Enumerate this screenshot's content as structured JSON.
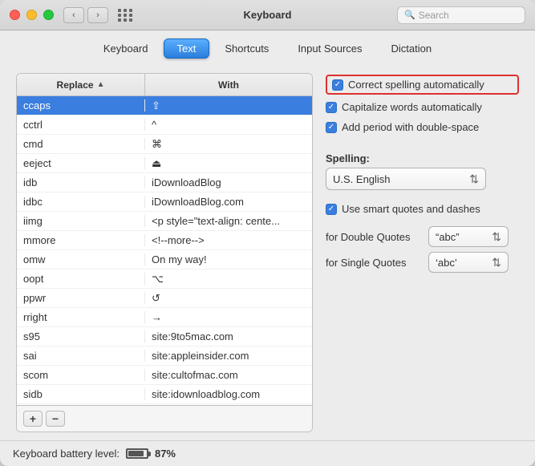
{
  "window": {
    "title": "Keyboard"
  },
  "titlebar": {
    "title": "Keyboard",
    "search_placeholder": "Search"
  },
  "tabs": [
    {
      "label": "Keyboard",
      "active": false
    },
    {
      "label": "Text",
      "active": true
    },
    {
      "label": "Shortcuts",
      "active": false
    },
    {
      "label": "Input Sources",
      "active": false
    },
    {
      "label": "Dictation",
      "active": false
    }
  ],
  "table": {
    "col_replace": "Replace",
    "col_with": "With",
    "rows": [
      {
        "replace": "ccaps",
        "with": "⇧",
        "selected": true
      },
      {
        "replace": "cctrl",
        "with": "^",
        "selected": false
      },
      {
        "replace": "cmd",
        "with": "⌘",
        "selected": false
      },
      {
        "replace": "eeject",
        "with": "⏏",
        "selected": false
      },
      {
        "replace": "idb",
        "with": "iDownloadBlog",
        "selected": false
      },
      {
        "replace": "idbc",
        "with": "iDownloadBlog.com",
        "selected": false
      },
      {
        "replace": "iimg",
        "with": "<p style=\"text-align: cente...",
        "selected": false
      },
      {
        "replace": "mmore",
        "with": "<!--more-->",
        "selected": false
      },
      {
        "replace": "omw",
        "with": "On my way!",
        "selected": false
      },
      {
        "replace": "oopt",
        "with": "⌥",
        "selected": false
      },
      {
        "replace": "ppwr",
        "with": "↺",
        "selected": false
      },
      {
        "replace": "rright",
        "with": "→",
        "selected": false
      },
      {
        "replace": "s95",
        "with": "site:9to5mac.com",
        "selected": false
      },
      {
        "replace": "sai",
        "with": "site:appleinsider.com",
        "selected": false
      },
      {
        "replace": "scom",
        "with": "site:cultofmac.com",
        "selected": false
      },
      {
        "replace": "sidb",
        "with": "site:idownloadblog.com",
        "selected": false
      }
    ]
  },
  "add_btn": "+",
  "remove_btn": "−",
  "right_panel": {
    "correct_spelling_label": "Correct spelling automatically",
    "capitalize_label": "Capitalize words automatically",
    "period_label": "Add period with double-space",
    "spelling_label": "Spelling:",
    "spelling_value": "U.S. English",
    "smart_quotes_label": "Use smart quotes and dashes",
    "double_quotes_label": "for Double Quotes",
    "double_quotes_value": "“abc”",
    "single_quotes_label": "for Single Quotes",
    "single_quotes_value": "‘abc’"
  },
  "bottom_bar": {
    "battery_label": "Keyboard battery level:",
    "battery_pct": "87%"
  }
}
